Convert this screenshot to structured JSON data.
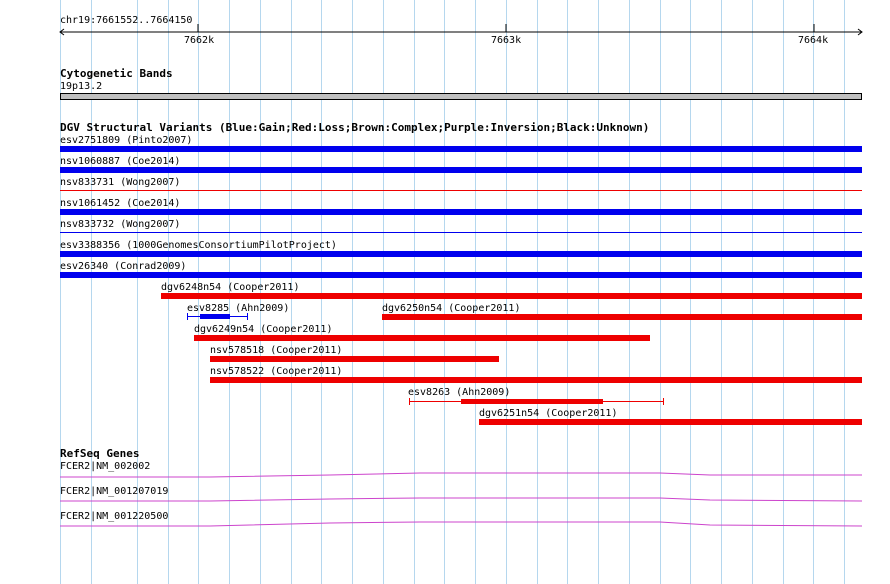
{
  "ruler": {
    "coordinate": "chr19:7661552..7664150",
    "tick_labels": [
      "7662k",
      "7663k",
      "7664k"
    ]
  },
  "cytoband": {
    "title": "Cytogenetic Bands",
    "band_label": "19p13.2",
    "band_color": "#bfbfbf"
  },
  "dgv": {
    "title": "DGV Structural Variants (Blue:Gain;Red:Loss;Brown:Complex;Purple:Inversion;Black:Unknown)",
    "colors": {
      "gain": "#0000ee",
      "loss": "#ee0000"
    },
    "variants": [
      {
        "label": "esv2751809 (Pinto2007)"
      },
      {
        "label": "nsv1060887 (Coe2014)"
      },
      {
        "label": "nsv833731 (Wong2007)"
      },
      {
        "label": "nsv1061452 (Coe2014)"
      },
      {
        "label": "nsv833732 (Wong2007)"
      },
      {
        "label": "esv3388356 (1000GenomesConsortiumPilotProject)"
      },
      {
        "label": "esv26340 (Conrad2009)"
      },
      {
        "label": "dgv6248n54 (Cooper2011)"
      },
      {
        "label": "esv8285 (Ahn2009)"
      },
      {
        "label": "dgv6250n54 (Cooper2011)"
      },
      {
        "label": "dgv6249n54 (Cooper2011)"
      },
      {
        "label": "nsv578518 (Cooper2011)"
      },
      {
        "label": "nsv578522 (Cooper2011)"
      },
      {
        "label": "esv8263 (Ahn2009)"
      },
      {
        "label": "dgv6251n54 (Cooper2011)"
      }
    ]
  },
  "refseq": {
    "title": "RefSeq Genes",
    "color": "#cc44cc",
    "genes": [
      {
        "label": "FCER2|NM_002002"
      },
      {
        "label": "FCER2|NM_001207019"
      },
      {
        "label": "FCER2|NM_001220500"
      }
    ]
  }
}
